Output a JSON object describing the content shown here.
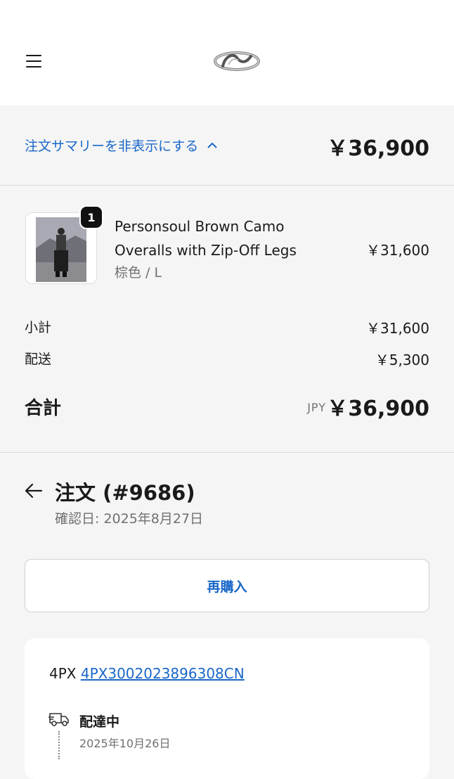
{
  "header": {
    "menu_icon": "hamburger-menu-icon",
    "logo": "brand-logo"
  },
  "summary": {
    "toggle_label": "注文サマリーを非表示にする",
    "toggle_icon": "chevron-up-icon",
    "total": "￥36,900"
  },
  "line_item": {
    "quantity": "1",
    "name_line1": "Personsoul Brown Camo",
    "name_line2": "Overalls with Zip-Off Legs",
    "variant": "棕色 / L",
    "price": "￥31,600"
  },
  "costs": {
    "subtotal_label": "小計",
    "subtotal_value": "￥31,600",
    "shipping_label": "配送",
    "shipping_value": "￥5,300",
    "total_label": "合計",
    "currency": "JPY",
    "total_value": "￥36,900"
  },
  "order": {
    "title": "注文 (#9686)",
    "confirmed": "確認日: 2025年8月27日",
    "rebuy_label": "再購入"
  },
  "shipment": {
    "carrier": "4PX",
    "tracking_number": "4PX3002023896308CN",
    "status": "配達中",
    "status_date": "2025年10月26日"
  },
  "colors": {
    "link": "#1a67c8",
    "background": "#f5f5f5"
  }
}
